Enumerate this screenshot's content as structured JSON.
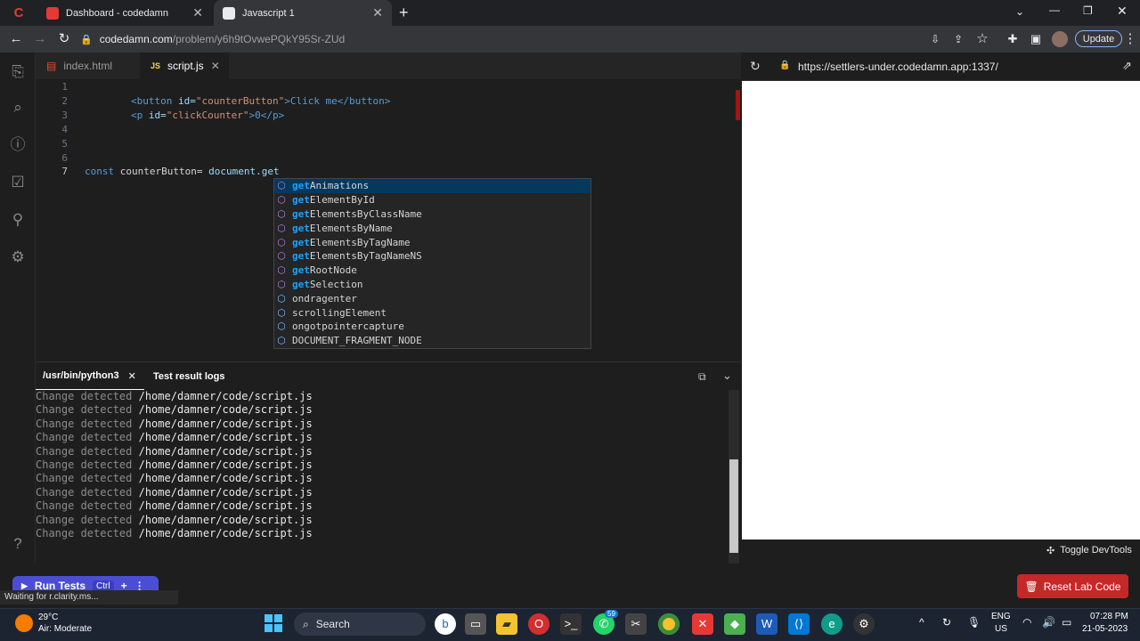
{
  "browser": {
    "tabs": [
      {
        "label": "Dashboard - codedamn",
        "favicon_color": "#e53935"
      },
      {
        "label": "Javascript 1",
        "favicon_color": "#e8eaed"
      }
    ],
    "new_tab": "+",
    "url_host": "codedamn.com",
    "url_path": "/problem/y6h9tOvwePQkY95Sr-ZUd",
    "update_label": "Update"
  },
  "editor": {
    "tabs": [
      {
        "label": "index.html",
        "icon_color": "#e44d26"
      },
      {
        "label": "script.js",
        "icon_color": "#f0db4f"
      }
    ],
    "lines": [
      {
        "n": "1",
        "text": ""
      },
      {
        "n": "2",
        "parts": [
          "<button id=\"counterButton\">Click me</button>"
        ]
      },
      {
        "n": "3",
        "parts": [
          "<p id=\"clickCounter\">0</p>"
        ]
      },
      {
        "n": "4",
        "text": ""
      },
      {
        "n": "5",
        "text": ""
      },
      {
        "n": "6",
        "text": ""
      },
      {
        "n": "7",
        "parts": [
          "const counterButton= document.get"
        ]
      }
    ],
    "line2": {
      "open": "<button ",
      "attr": "id=",
      "val": "\"counterButton\"",
      "close": ">Click me</button>"
    },
    "line3": {
      "open": "<p ",
      "attr": "id=",
      "val": "\"clickCounter\"",
      "close": ">0</p>"
    },
    "line7": {
      "kw": "const",
      "var": " counterButton=",
      "obj": " document.get"
    },
    "suggestions": [
      {
        "match": "get",
        "rest": "Animations",
        "type": "method"
      },
      {
        "match": "get",
        "rest": "ElementById",
        "type": "method"
      },
      {
        "match": "get",
        "rest": "ElementsByClassName",
        "type": "method"
      },
      {
        "match": "get",
        "rest": "ElementsByName",
        "type": "method"
      },
      {
        "match": "get",
        "rest": "ElementsByTagName",
        "type": "method"
      },
      {
        "match": "get",
        "rest": "ElementsByTagNameNS",
        "type": "method"
      },
      {
        "match": "get",
        "rest": "RootNode",
        "type": "method"
      },
      {
        "match": "get",
        "rest": "Selection",
        "type": "method"
      },
      {
        "match": "",
        "rest": "ondragenter",
        "type": "field"
      },
      {
        "match": "",
        "rest": "scrollingElement",
        "type": "field"
      },
      {
        "match": "",
        "rest": "ongotpointercapture",
        "type": "field"
      },
      {
        "match": "",
        "rest": "DOCUMENT_FRAGMENT_NODE",
        "type": "field"
      }
    ]
  },
  "preview": {
    "url": "https://settlers-under.codedamn.app:1337/",
    "toggle_devtools": "Toggle DevTools"
  },
  "terminal": {
    "tabs": [
      "/usr/bin/python3",
      "Test result logs"
    ],
    "lines": [
      "/home/damner/code/script.js",
      "/home/damner/code/script.js",
      "/home/damner/code/script.js",
      "/home/damner/code/script.js",
      "/home/damner/code/script.js",
      "/home/damner/code/script.js",
      "/home/damner/code/script.js",
      "/home/damner/code/script.js",
      "/home/damner/code/script.js",
      "/home/damner/code/script.js",
      "/home/damner/code/script.js"
    ],
    "prefix": "Change detected"
  },
  "actions": {
    "run_tests": "Run Tests",
    "run_shortcut": "Ctrl",
    "run_plus": "+",
    "reset": "Reset Lab Code",
    "status_tip": "Waiting for r.clarity.ms..."
  },
  "taskbar": {
    "weather_temp": "29°C",
    "weather_desc": "Air: Moderate",
    "search": "Search",
    "lang1": "ENG",
    "lang2": "US",
    "time": "07:28 PM",
    "date": "21-05-2023",
    "badge": "59"
  }
}
